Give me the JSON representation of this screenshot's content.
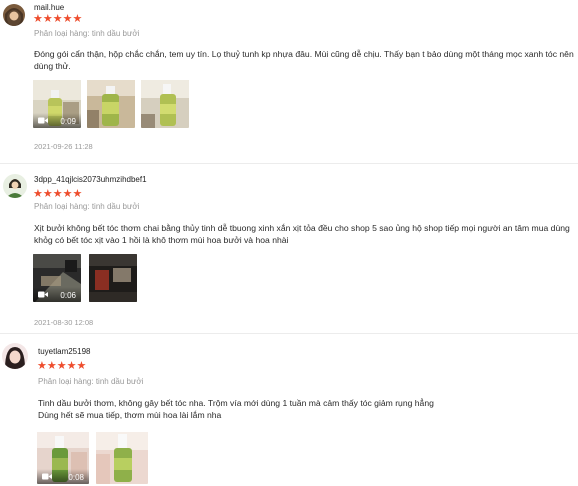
{
  "reviews": [
    {
      "username": "mail.hue",
      "stars": "★★★★★",
      "variant": "Phân loại hàng: tinh dầu bưởi",
      "comment": "Đóng gói cẩn thận, hộp chắc chắn, tem uy tín. Lọ thuỷ tunh kp nhựa đâu. Mùi cũng dễ chịu. Thấy bạn t bảo dùng một tháng mọc xanh tóc nên dùng thử.",
      "media": [
        {
          "type": "video",
          "duration": "0:09",
          "camera_icon": "video-camera-icon"
        },
        {
          "type": "image"
        },
        {
          "type": "image"
        }
      ],
      "timestamp": "2021-09-26 11:28"
    },
    {
      "username": "3dpp_41qjlcis2073uhmzihdbef1",
      "stars": "★★★★★",
      "variant": "Phân loại hàng: tinh dầu bưởi",
      "comment": "Xịt bưởi không bết tóc thơm chai bằng thủy tinh dễ tbuong xinh xắn xịt tỏa đều cho shop 5 sao ủng hộ shop tiếp mọi người an tâm mua dùng khỏg có bết tóc xịt vào 1 hồi là khô thơm mùi hoa bưởi và hoa nhài",
      "media": [
        {
          "type": "video",
          "duration": "0:06",
          "camera_icon": "video-camera-icon"
        },
        {
          "type": "image"
        }
      ],
      "timestamp": "2021-08-30 12:08"
    },
    {
      "username": "tuyetlam25198",
      "stars": "★★★★★",
      "variant": "Phân loại hàng: tinh dầu bưởi",
      "comment_lines": [
        "Tinh dầu bưởi thơm, không gây bết tóc nha. Trộm vía mới dùng 1 tuần mà cảm thấy tóc giảm rụng hẳng",
        "Dùng hết sẽ mua tiếp, thơm mùi hoa lài lắm nha"
      ],
      "media": [
        {
          "type": "video",
          "duration": "0:08",
          "camera_icon": "video-camera-icon"
        },
        {
          "type": "image"
        }
      ]
    }
  ],
  "colors": {
    "star": "#ee4d2d",
    "muted": "#9a9a9a",
    "divider": "#ececec"
  }
}
